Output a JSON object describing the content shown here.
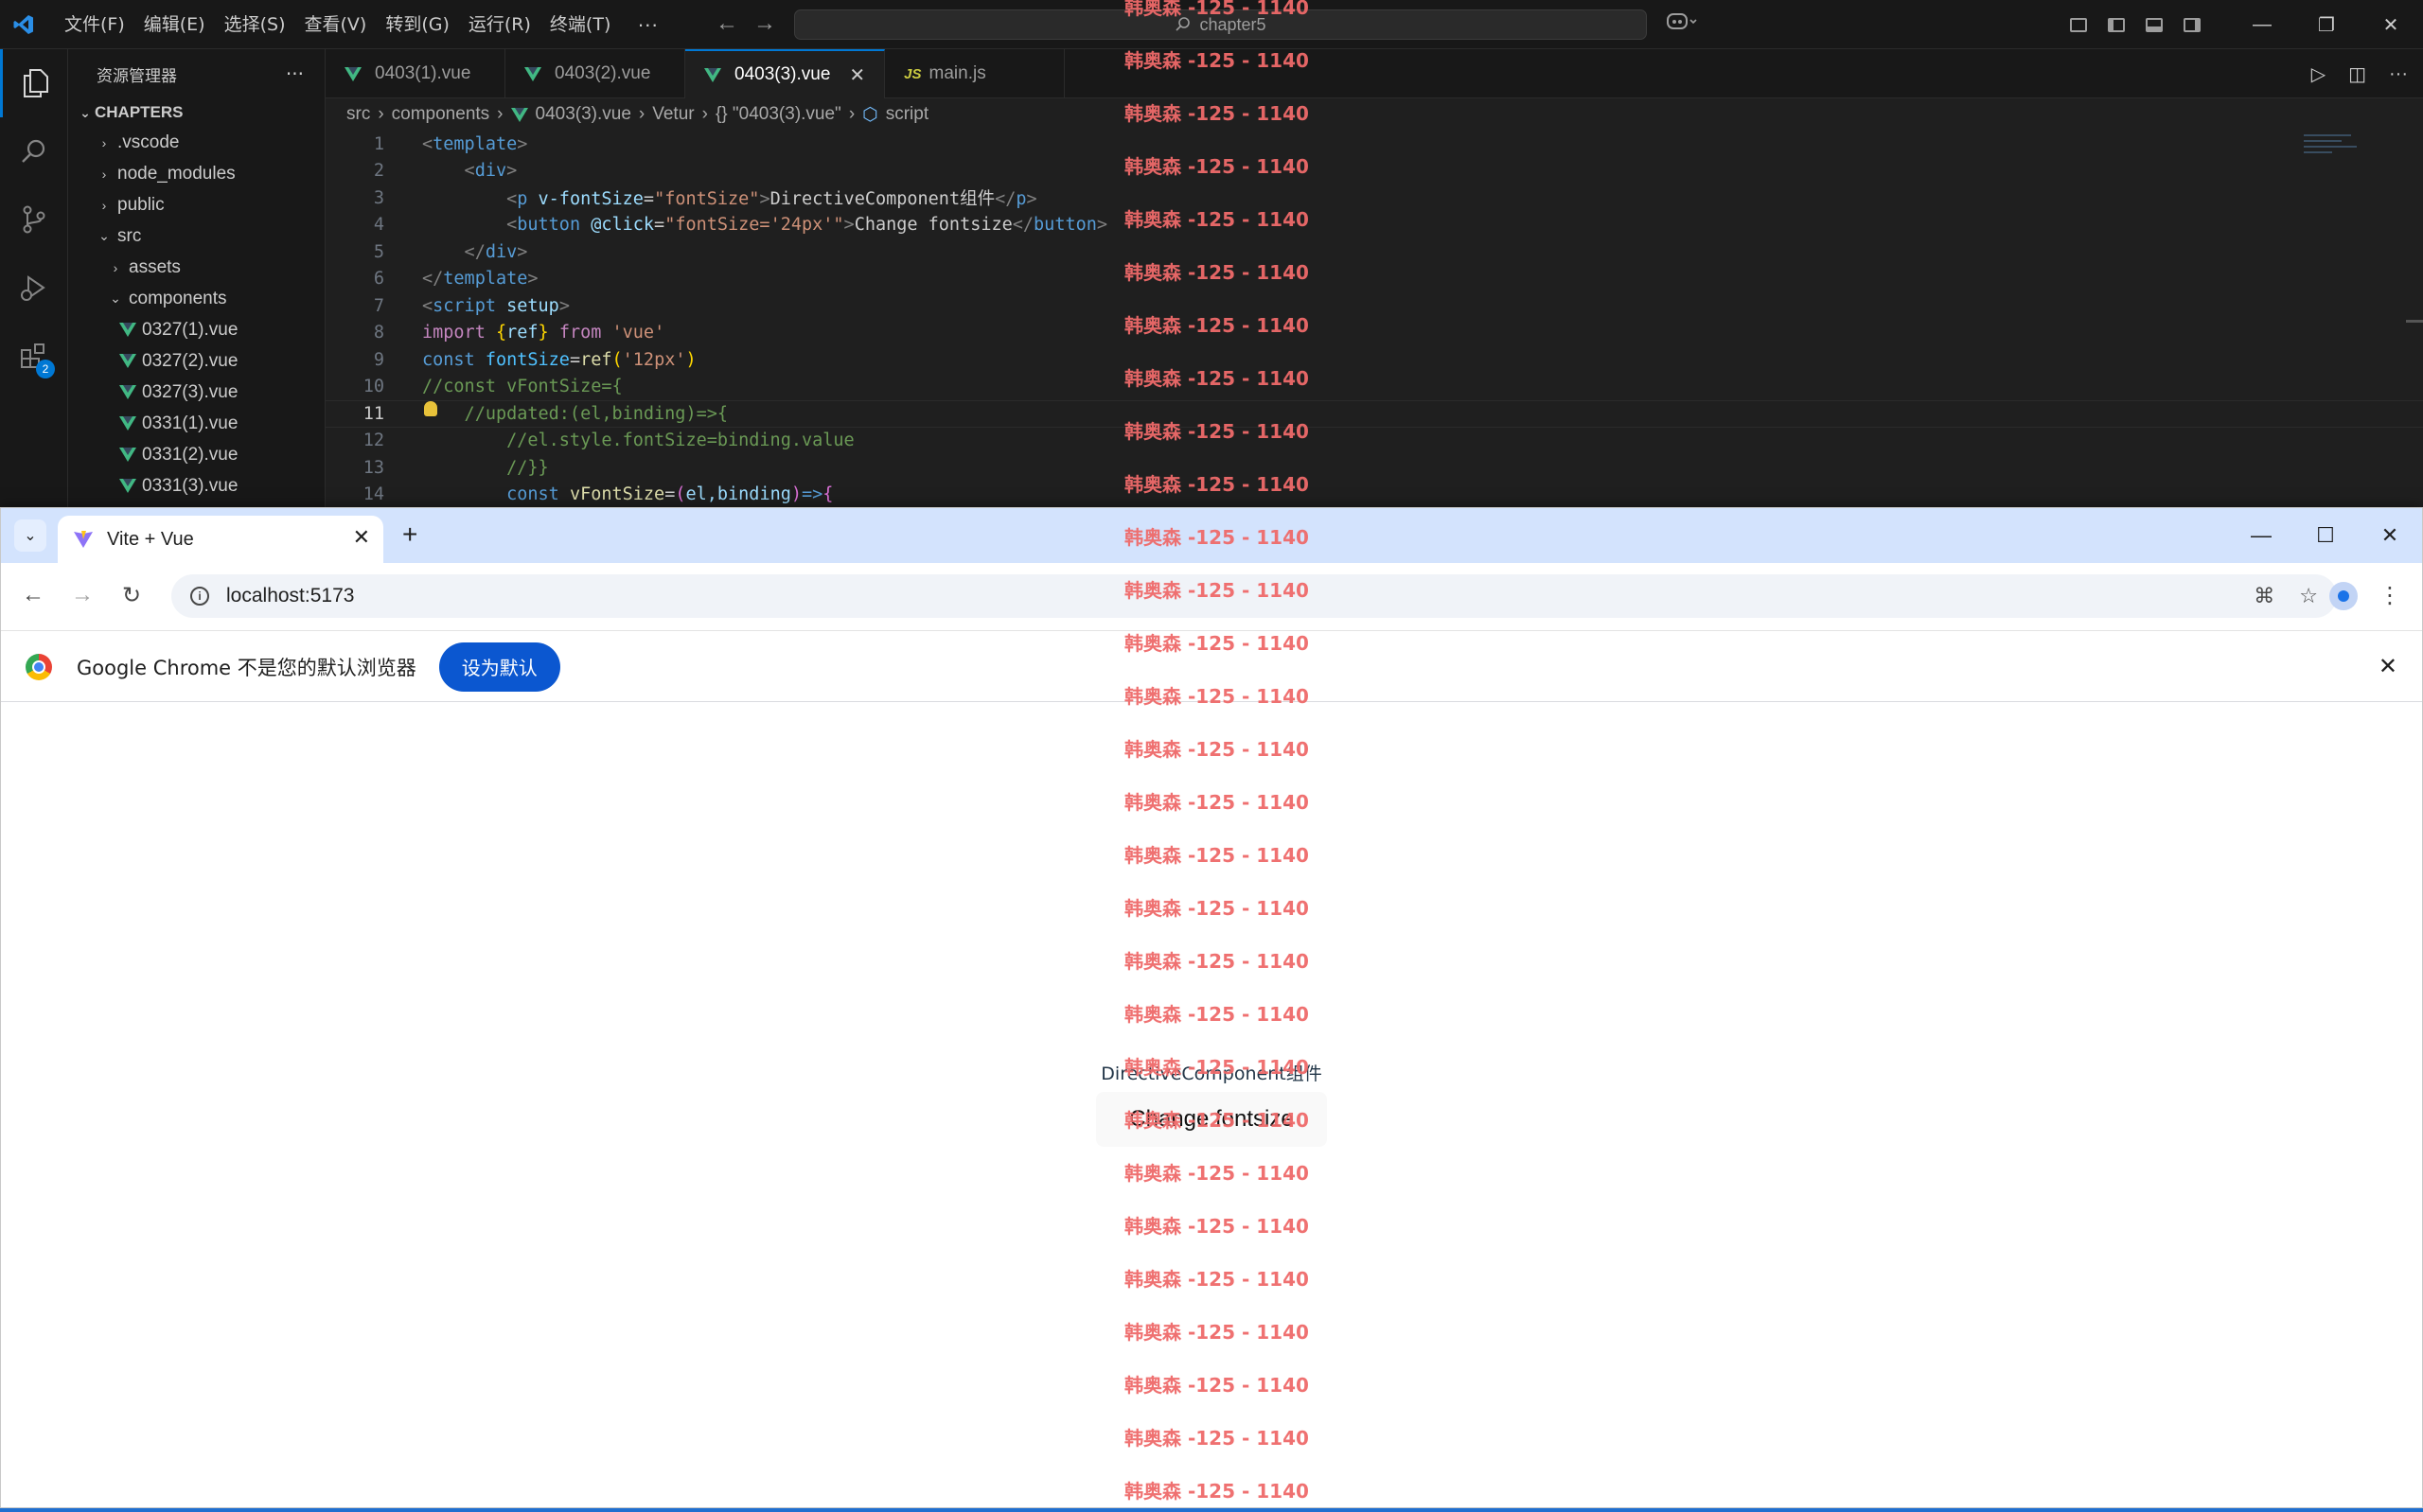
{
  "vscode": {
    "menu": [
      "文件(F)",
      "编辑(E)",
      "选择(S)",
      "查看(V)",
      "转到(G)",
      "运行(R)",
      "终端(T)"
    ],
    "menu_more": "···",
    "search_text": "chapter5",
    "explorer_title": "资源管理器",
    "explorer_more": "···",
    "section_title": "CHAPTERS",
    "tree": [
      {
        "label": ".vscode",
        "chev": "›"
      },
      {
        "label": "node_modules",
        "chev": "›"
      },
      {
        "label": "public",
        "chev": "›"
      },
      {
        "label": "src",
        "chev": "⌄"
      },
      {
        "label": "assets",
        "chev": "›"
      },
      {
        "label": "components",
        "chev": "⌄"
      },
      {
        "label": "0327(1).vue"
      },
      {
        "label": "0327(2).vue"
      },
      {
        "label": "0327(3).vue"
      },
      {
        "label": "0331(1).vue"
      },
      {
        "label": "0331(2).vue"
      },
      {
        "label": "0331(3).vue"
      }
    ],
    "extensions_badge": "2",
    "tabs": [
      {
        "label": "0403(1).vue"
      },
      {
        "label": "0403(2).vue"
      },
      {
        "label": "0403(3).vue"
      },
      {
        "label": "main.js",
        "icon": "JS"
      }
    ],
    "tab_close": "✕",
    "breadcrumb": [
      "src",
      "components",
      "0403(3).vue",
      "Vetur",
      "{} \"0403(3).vue\"",
      "script"
    ],
    "line_numbers": [
      "1",
      "2",
      "3",
      "4",
      "5",
      "6",
      "7",
      "8",
      "9",
      "10",
      "11",
      "12",
      "13",
      "14"
    ],
    "code": {
      "l1": [
        "<",
        "template",
        ">"
      ],
      "l2": [
        "    <",
        "div",
        ">"
      ],
      "l3": [
        "        <",
        "p",
        " ",
        "v-fontSize",
        "=",
        "\"fontSize\"",
        ">",
        "DirectiveComponent组件",
        "</",
        "p",
        ">"
      ],
      "l4": [
        "        <",
        "button",
        " ",
        "@click",
        "=",
        "\"fontSize='24px'\"",
        ">",
        "Change fontsize",
        "</",
        "button",
        ">"
      ],
      "l5": [
        "    </",
        "div",
        ">"
      ],
      "l6": [
        "</",
        "template",
        ">"
      ],
      "l7": [
        "<",
        "script",
        " ",
        "setup",
        ">"
      ],
      "l8": [
        "import",
        " ",
        "{",
        "ref",
        "}",
        " ",
        "from",
        " ",
        "'vue'"
      ],
      "l9": [
        "const",
        " ",
        "fontSize",
        "=",
        "ref",
        "(",
        "'12px'",
        ")"
      ],
      "l10": "//const vFontSize={",
      "l11": "    //updated:(el,binding)=>{",
      "l12": "        //el.style.fontSize=binding.value",
      "l13": "        //}}",
      "l14": [
        "        ",
        "const",
        " ",
        "vFontSize",
        "=",
        "(",
        "el,binding",
        ")",
        "=>",
        "{"
      ]
    }
  },
  "chrome": {
    "tab_title": "Vite + Vue",
    "tab_close": "✕",
    "new_tab": "+",
    "url": "localhost:5173",
    "infobar_text": "Google Chrome 不是您的默认浏览器",
    "infobar_button": "设为默认",
    "infobar_close": "✕",
    "page": {
      "paragraph": "DirectiveComponent组件",
      "button": "Change fontsize"
    }
  },
  "watermark": {
    "text": "韩奥森 -125 - 1140",
    "color": "#ef6a6a"
  }
}
